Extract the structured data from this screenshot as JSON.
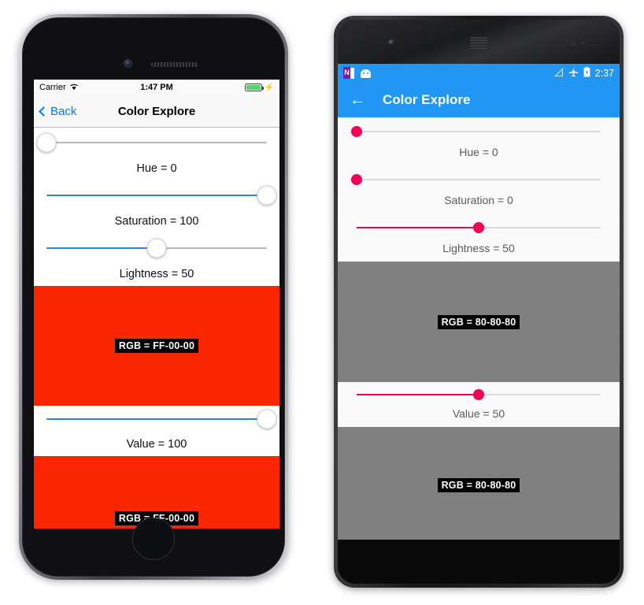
{
  "iphone": {
    "status": {
      "carrier": "Carrier",
      "wifi_icon": "wifi-icon",
      "time": "1:47 PM",
      "battery_icon": "battery-charging-icon",
      "bolt": "⚡"
    },
    "nav": {
      "back_label": "Back",
      "back_icon": "chevron-left-icon",
      "title": "Color Explore"
    },
    "sliders": [
      {
        "name": "hue",
        "label": "Hue = 0",
        "percent": 0,
        "fill_percent": 0
      },
      {
        "name": "saturation",
        "label": "Saturation = 100",
        "percent": 100,
        "fill_percent": 100
      },
      {
        "name": "lightness",
        "label": "Lightness = 50",
        "percent": 50,
        "fill_percent": 50
      },
      {
        "name": "value",
        "label": "Value = 100",
        "percent": 100,
        "fill_percent": 100
      }
    ],
    "swatches": [
      {
        "name": "hsl-swatch",
        "color": "#FA2600",
        "rgb_label": "RGB = FF-00-00"
      },
      {
        "name": "hsv-swatch",
        "color": "#FA2600",
        "rgb_label": "RGB = FF-00-00"
      }
    ],
    "accent_color": "#2f80ed"
  },
  "android": {
    "status": {
      "onenote_icon": "onenote-icon",
      "android_icon": "android-robot-icon",
      "signal_icon": "signal-none-icon",
      "airplane_icon": "airplane-mode-icon",
      "battery_icon": "battery-charging-icon",
      "time": "2:37"
    },
    "toolbar": {
      "back_icon": "arrow-left-icon",
      "back_glyph": "←",
      "title": "Color Explore"
    },
    "sliders": [
      {
        "name": "hue",
        "label": "Hue = 0",
        "percent": 0,
        "fill_percent": 0
      },
      {
        "name": "saturation",
        "label": "Saturation = 0",
        "percent": 0,
        "fill_percent": 0
      },
      {
        "name": "lightness",
        "label": "Lightness = 50",
        "percent": 50,
        "fill_percent": 50
      },
      {
        "name": "value",
        "label": "Value = 50",
        "percent": 50,
        "fill_percent": 50
      }
    ],
    "swatches": [
      {
        "name": "hsl-swatch",
        "color": "#808080",
        "rgb_label": "RGB = 80-80-80"
      },
      {
        "name": "hsv-swatch",
        "color": "#808080",
        "rgb_label": "RGB = 80-80-80"
      }
    ],
    "nav": {
      "back": "nav-back-button",
      "home": "nav-home-button",
      "recents": "nav-recents-button"
    },
    "accent_color": "#f50057",
    "toolbar_color": "#2196F3"
  }
}
